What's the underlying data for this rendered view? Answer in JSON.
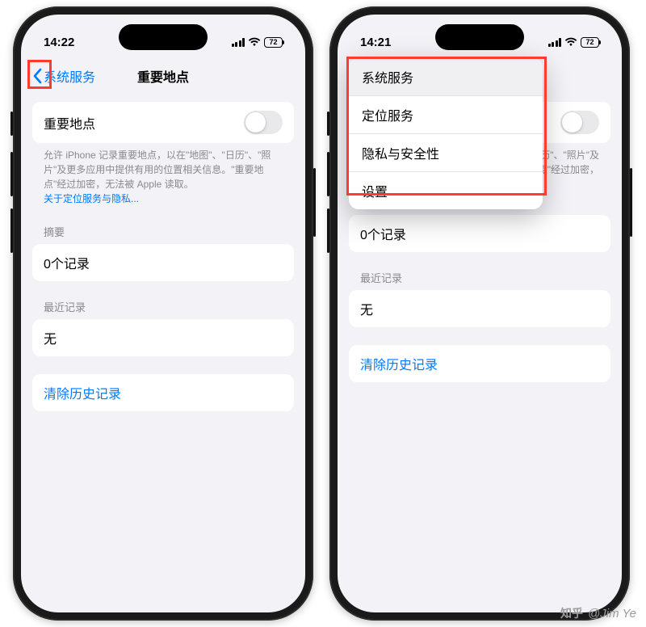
{
  "watermark": {
    "brand": "知乎",
    "author": "@Jim Ye"
  },
  "status": {
    "time_left": "14:22",
    "time_right": "14:21",
    "battery": "72"
  },
  "nav": {
    "back_label": "系统服务",
    "title": "重要地点"
  },
  "toggle_row": {
    "label": "重要地点"
  },
  "description": {
    "line1": "允许 iPhone 记录重要地点，以在\"地图\"、\"日历\"、\"照片\"及更多应用中提供有用的位置相关信息。\"重要地点\"经过加密，无法被 Apple 读取。",
    "link": "关于定位服务与隐私..."
  },
  "summary": {
    "header": "摘要",
    "value": "0个记录"
  },
  "recent": {
    "header": "最近记录",
    "value": "无"
  },
  "clear": {
    "label": "清除历史记录"
  },
  "breadcrumbs": {
    "items": [
      "系统服务",
      "定位服务",
      "隐私与安全性",
      "设置"
    ]
  },
  "right_partial": {
    "desc_tail1": "\"日历\"、\"照片\"及",
    "desc_tail2": "要地点\"经过加密，",
    "link_tail": "关于定位服务与隐私..."
  }
}
